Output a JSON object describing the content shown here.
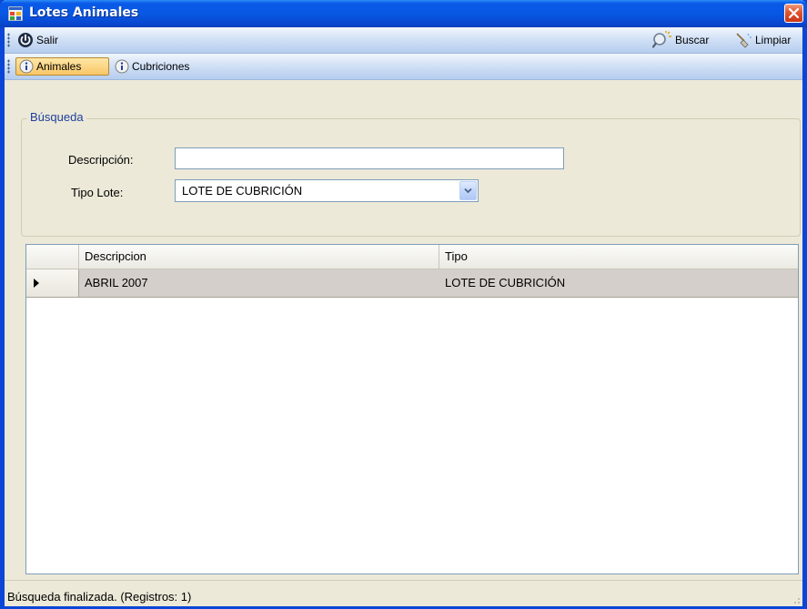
{
  "window": {
    "title": "Lotes Animales",
    "accent": "#0b46d6"
  },
  "toolbar_main": {
    "salir_label": "Salir",
    "buscar_label": "Buscar",
    "limpiar_label": "Limpiar"
  },
  "toolbar_tabs": {
    "animales_label": "Animales",
    "cubriciones_label": "Cubriciones"
  },
  "search": {
    "group_label": "Búsqueda",
    "descripcion_label": "Descripción:",
    "descripcion_value": "",
    "tipo_label": "Tipo Lote:",
    "tipo_value": "LOTE DE CUBRICIÓN"
  },
  "grid": {
    "columns": [
      "Descripcion",
      "Tipo"
    ],
    "rows": [
      {
        "descripcion": "ABRIL 2007",
        "tipo": "LOTE DE CUBRICIÓN"
      }
    ]
  },
  "status": {
    "text": "Búsqueda finalizada. (Registros: 1)"
  },
  "icons": {
    "app": "window-app-icon",
    "close": "close-icon",
    "salir": "power-icon",
    "buscar": "search-icon",
    "limpiar": "broom-icon",
    "info": "info-icon",
    "dropdown": "chevron-down-icon",
    "row_pointer": "row-pointer-icon"
  }
}
